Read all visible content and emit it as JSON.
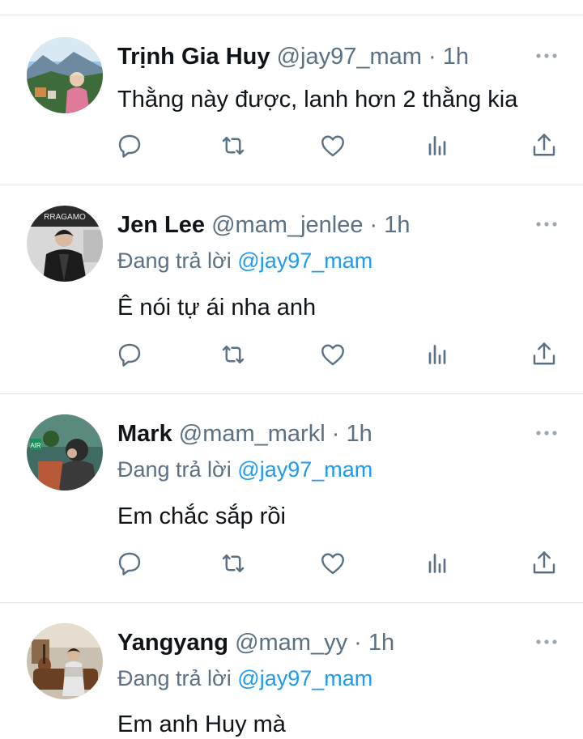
{
  "tweets": [
    {
      "name": "Trịnh Gia Huy",
      "handle": "@jay97_mam",
      "time": "1h",
      "reply_prefix": "",
      "reply_to": "",
      "text": "Thằng này được, lanh hơn 2 thằng kia",
      "avatar": "avatar-landscape"
    },
    {
      "name": "Jen Lee",
      "handle": "@mam_jenlee",
      "time": "1h",
      "reply_prefix": "Đang trả lời",
      "reply_to": "@jay97_mam",
      "text": "Ê nói tự ái nha anh",
      "avatar": "avatar-leather-jacket"
    },
    {
      "name": "Mark",
      "handle": "@mam_markl",
      "time": "1h",
      "reply_prefix": "Đang trả lời",
      "reply_to": "@jay97_mam",
      "text": "Em chắc sắp rồi",
      "avatar": "avatar-green-room"
    },
    {
      "name": "Yangyang",
      "handle": "@mam_yy",
      "time": "1h",
      "reply_prefix": "Đang trả lời",
      "reply_to": "@jay97_mam",
      "text": "Em anh Huy mà",
      "avatar": "avatar-guitar-room"
    }
  ],
  "dot_separator": "·",
  "icons": [
    "reply-icon",
    "retweet-icon",
    "like-icon",
    "analytics-icon",
    "share-icon",
    "more-icon"
  ],
  "colors": {
    "text": "#0f1419",
    "secondary": "#5b7083",
    "mention": "#1d9bf0",
    "divider": "#dfe3e6"
  }
}
